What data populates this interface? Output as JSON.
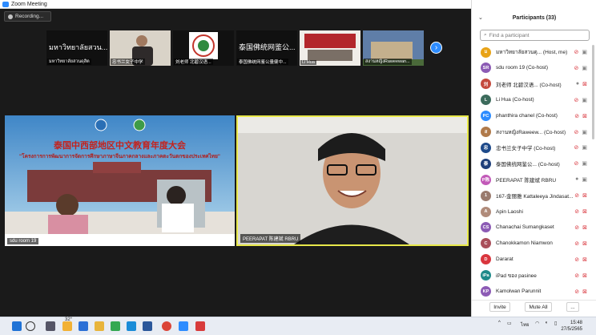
{
  "window": {
    "title": "Zoom Meeting",
    "minimize": "–",
    "maximize": "□",
    "close": "×"
  },
  "recording": {
    "label": "Recording..."
  },
  "strip": {
    "thumbs": [
      {
        "big": "มหาวิทยาลัยสวน...",
        "label": "มหาวิทยาลัยสวนดุสิต"
      },
      {
        "label": "忠书兰女子中学"
      },
      {
        "label": "刘老师 北碧汉语..."
      },
      {
        "big": "泰国佛统网鉴公...",
        "label": "泰国佛统网鉴公量健中..."
      },
      {
        "label": "Li Hua"
      },
      {
        "label": "สงานหญิงRaweewan..."
      }
    ],
    "next": "›"
  },
  "videos": {
    "left": {
      "name": "sdu room 19",
      "banner_cn": "泰国中西部地区中文教育年度大会",
      "banner_th": "\"โครงการการพัฒนาการจัดการศึกษาภาษาจีนภาคกลางและภาคตะวันตกของประเทศไทย\""
    },
    "right": {
      "name": "PEERAPAT 陈建斌 RBRU"
    }
  },
  "panel": {
    "title": "Participants (33)",
    "search_placeholder": "Find a participant",
    "participants": [
      {
        "initials": "ม",
        "color": "#e8a317",
        "name": "มหาวิทยาลัยสวนดุ... (Host, me)",
        "mic": "muted",
        "cam": "on"
      },
      {
        "initials": "SR",
        "color": "#8c5bb5",
        "name": "sdu room 19 (Co-host)",
        "mic": "muted",
        "cam": "on"
      },
      {
        "initials": "刘",
        "color": "#c44a3d",
        "name": "刘老师 北碧汉语... (Co-host)",
        "mic": "on",
        "cam": "muted"
      },
      {
        "initials": "L",
        "color": "#3c6b5c",
        "name": "Li Hua (Co-host)",
        "mic": "muted",
        "cam": "on"
      },
      {
        "initials": "PC",
        "color": "#2d8cff",
        "name": "phanthira chanel (Co-host)",
        "mic": "muted",
        "cam": "muted"
      },
      {
        "initials": "ส",
        "color": "#b07a4a",
        "name": "สงานหญิงRaweew... (Co-host)",
        "mic": "muted",
        "cam": "on"
      },
      {
        "initials": "忠",
        "color": "#1e4a8a",
        "name": "忠书兰女子中学 (Co-host)",
        "mic": "muted",
        "cam": "on"
      },
      {
        "initials": "泰",
        "color": "#1e3f7a",
        "name": "泰国佛统网鉴公... (Co-host)",
        "mic": "muted",
        "cam": "on"
      },
      {
        "initials": "P陈",
        "color": "#c259b8",
        "name": "PEERAPAT 陈建斌 RBRU",
        "mic": "on",
        "cam": "on"
      },
      {
        "initials": "1",
        "color": "#9a7b6e",
        "name": "167-金丽雅 Kattaleeya Jindasat...",
        "mic": "muted",
        "cam": "muted"
      },
      {
        "initials": "A",
        "color": "#b08b7a",
        "name": "Apin Laoshi",
        "mic": "muted",
        "cam": "muted"
      },
      {
        "initials": "CS",
        "color": "#8c5bb5",
        "name": "Chanachai Sumangkaset",
        "mic": "muted",
        "cam": "muted"
      },
      {
        "initials": "C",
        "color": "#a94f5a",
        "name": "Chanokkamon Niamwon",
        "mic": "muted",
        "cam": "muted"
      },
      {
        "initials": "D",
        "color": "#d9363e",
        "name": "Dararat",
        "mic": "muted",
        "cam": "muted"
      },
      {
        "initials": "iPa",
        "color": "#1f8a8a",
        "name": "iPad ของ pasinee",
        "mic": "muted",
        "cam": "muted"
      },
      {
        "initials": "KP",
        "color": "#8c5bb5",
        "name": "Kamolwan Parunnit",
        "mic": "muted",
        "cam": "muted"
      }
    ],
    "invite": "Invite",
    "mute_all": "Mute All",
    "more": "..."
  },
  "taskbar": {
    "weather": "32°",
    "lang": "ไทย",
    "time": "15:48",
    "date": "27/5/2565"
  }
}
